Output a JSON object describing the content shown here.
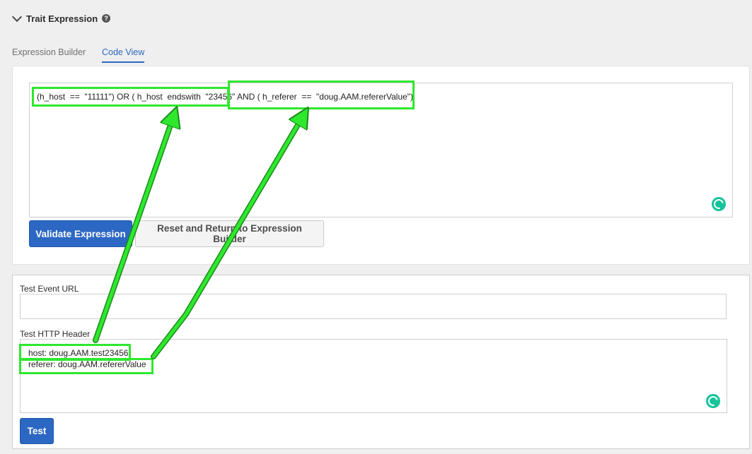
{
  "section": {
    "title": "Trait Expression",
    "help_icon": "?"
  },
  "tabs": [
    {
      "label": "Expression Builder",
      "active": false
    },
    {
      "label": "Code View",
      "active": true
    }
  ],
  "code_view": {
    "expression_part1": "(h_host  ==  \"11111\") OR ( h_host  endswith  \"23456\"",
    "expression_part2": "AND ( h_referer  ==  \"doug.AAM.refererValue\")"
  },
  "buttons": {
    "validate": "Validate Expression",
    "reset": "Reset and Return to Expression Builder",
    "test": "Test"
  },
  "test_panel": {
    "event_url_label": "Test Event URL",
    "event_url_value": "",
    "http_header_label": "Test HTTP Header",
    "header_lines": [
      "host: doug.AAM.test23456",
      "referer: doug.AAM.refererValue"
    ]
  },
  "colors": {
    "accent": "#2c67c4",
    "annotation": "#2ee82e",
    "grammarly": "#15c39a"
  }
}
